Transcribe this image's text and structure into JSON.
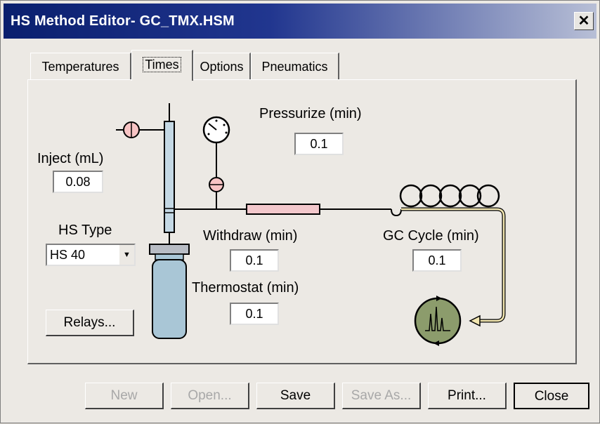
{
  "window": {
    "title": "HS Method Editor- GC_TMX.HSM",
    "close_glyph": "✕"
  },
  "tabs": [
    {
      "label": "Temperatures",
      "active": false
    },
    {
      "label": "Times",
      "active": true
    },
    {
      "label": "Options",
      "active": false
    },
    {
      "label": "Pneumatics",
      "active": false
    }
  ],
  "fields": {
    "inject": {
      "label": "Inject (mL)",
      "value": "0.08"
    },
    "pressurize": {
      "label": "Pressurize (min)",
      "value": "0.1"
    },
    "withdraw": {
      "label": "Withdraw (min)",
      "value": "0.1"
    },
    "thermostat": {
      "label": "Thermostat (min)",
      "value": "0.1"
    },
    "gc_cycle": {
      "label": "GC Cycle (min)",
      "value": "0.1"
    }
  },
  "hs_type": {
    "label": "HS Type",
    "value": "HS 40",
    "arrow": "▼"
  },
  "relays_button": "Relays...",
  "buttons": {
    "new": "New",
    "open": "Open...",
    "save": "Save",
    "save_as": "Save As...",
    "print": "Print...",
    "close": "Close"
  },
  "colors": {
    "titlebar_start": "#0a1f6e",
    "vial": "#a9c6d6",
    "column": "#f3c8cc",
    "detector": "#8c9c6c",
    "valve": "#f7c4c4"
  },
  "icons": [
    "valve-icon",
    "pressure-gauge-icon",
    "vial-icon",
    "transfer-line-icon",
    "gc-column-coil-icon",
    "detector-chromatogram-icon"
  ]
}
